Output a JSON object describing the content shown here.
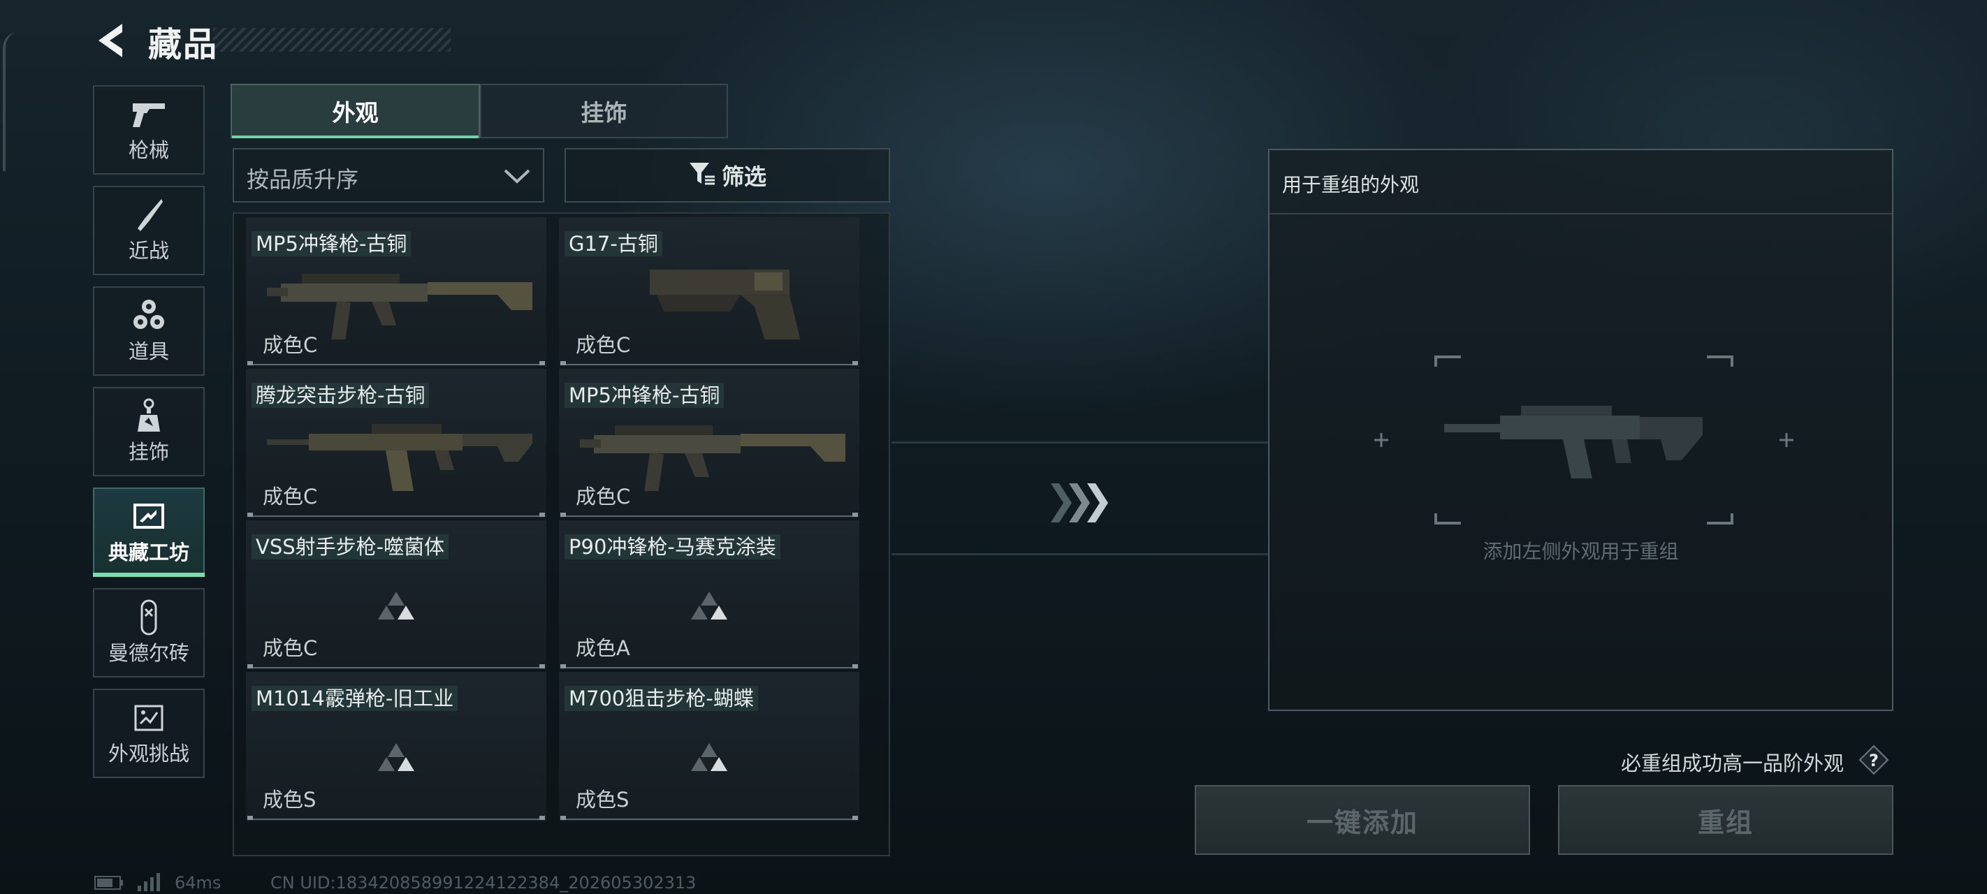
{
  "header": {
    "title": "藏品",
    "back_icon": "chevron-left-icon"
  },
  "sidebar": {
    "items": [
      {
        "label": "枪械",
        "icon": "pistol-icon",
        "active": false
      },
      {
        "label": "近战",
        "icon": "knife-icon",
        "active": false
      },
      {
        "label": "道具",
        "icon": "cubes-icon",
        "active": false
      },
      {
        "label": "挂饰",
        "icon": "charm-icon",
        "active": false
      },
      {
        "label": "典藏工坊",
        "icon": "workshop-icon",
        "active": true
      },
      {
        "label": "曼德尔砖",
        "icon": "brick-icon",
        "active": false
      },
      {
        "label": "外观挑战",
        "icon": "challenge-icon",
        "active": false
      }
    ]
  },
  "tabs": [
    {
      "label": "外观",
      "active": true
    },
    {
      "label": "挂饰",
      "active": false
    }
  ],
  "sort": {
    "value": "按品质升序"
  },
  "filter": {
    "label": "筛选"
  },
  "items": [
    {
      "name": "MP5冲锋枪-古铜",
      "grade": "成色C",
      "image": "smg-mp5"
    },
    {
      "name": "G17-古铜",
      "grade": "成色C",
      "image": "pistol-g17"
    },
    {
      "name": "腾龙突击步枪-古铜",
      "grade": "成色C",
      "image": "rifle-tenglong"
    },
    {
      "name": "MP5冲锋枪-古铜",
      "grade": "成色C",
      "image": "smg-mp5"
    },
    {
      "name": "VSS射手步枪-噬菌体",
      "grade": "成色C",
      "image": "placeholder"
    },
    {
      "name": "P90冲锋枪-马赛克涂装",
      "grade": "成色A",
      "image": "placeholder"
    },
    {
      "name": "M1014霰弹枪-旧工业",
      "grade": "成色S",
      "image": "placeholder"
    },
    {
      "name": "M700狙击步枪-蝴蝶",
      "grade": "成色S",
      "image": "placeholder"
    }
  ],
  "remix": {
    "panel_title": "用于重组的外观",
    "hint": "添加左侧外观用于重组",
    "tip": "必重组成功高一品阶外观",
    "add_all_label": "一键添加",
    "remix_label": "重组"
  },
  "status": {
    "ping": "64ms",
    "uid": "CN UID:1834208589912241223​84_202605302313"
  },
  "colors": {
    "accent": "#6fd3a6",
    "panel_border": "#4c5a60"
  }
}
